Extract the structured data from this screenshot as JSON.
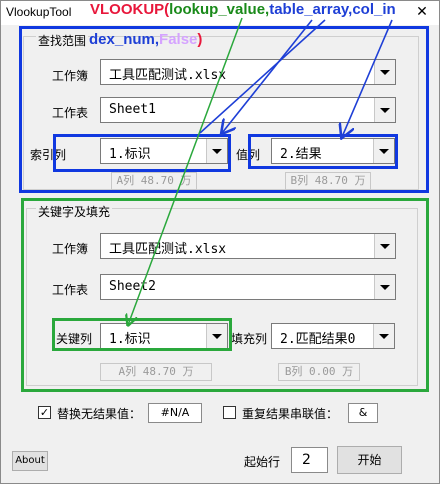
{
  "window": {
    "title": "VlookupTool",
    "close_glyph": "✕"
  },
  "annotation": {
    "formula_prefix": "VLOOKUP(",
    "formula_arg1": "lookup_value,",
    "formula_arg2": "table_array,",
    "formula_arg3a": "col_in",
    "formula_arg3b": "dex_num,",
    "formula_arg4": "False",
    "formula_suffix": ")",
    "colors": {
      "red": "#e8173b",
      "green": "#1a8a1a",
      "blue": "#1e3fd6",
      "lilac": "#d5a3ff"
    }
  },
  "search_range": {
    "group_title": "查找范围",
    "workbook_label": "工作簿",
    "workbook_value": "工具匹配测试.xlsx",
    "sheet_label": "工作表",
    "sheet_value": "Sheet1",
    "index_col_label": "索引列",
    "index_col_value": "1.标识",
    "value_col_label": "值列",
    "value_col_value": "2.结果",
    "index_info": "A列 48.70 万",
    "value_info": "B列 48.70 万"
  },
  "key_fill": {
    "group_title": "关键字及填充",
    "workbook_label": "工作簿",
    "workbook_value": "工具匹配测试.xlsx",
    "sheet_label": "工作表",
    "sheet_value": "Sheet2",
    "key_col_label": "关键列",
    "key_col_value": "1.标识",
    "fill_col_label": "填充列",
    "fill_col_value": "2.匹配结果0",
    "key_info": "A列 48.70 万",
    "fill_info": "B列 0.00 万"
  },
  "options": {
    "replace_checked": true,
    "replace_label": "替换无结果值：",
    "replace_value": "#N/A",
    "concat_checked": false,
    "concat_label": "重复结果串联值：",
    "concat_value": "&"
  },
  "footer": {
    "about_label": "About",
    "start_row_label": "起始行",
    "start_row_value": "2",
    "start_label": "开始"
  }
}
